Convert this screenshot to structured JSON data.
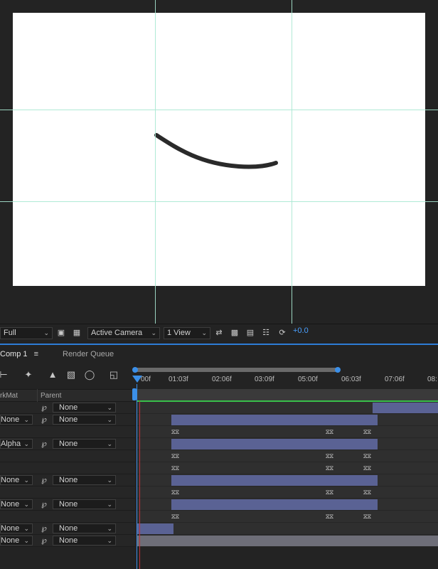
{
  "viewer": {
    "resolution": "Full",
    "camera": "Active Camera",
    "views": "1 View",
    "exposure": "+0.0"
  },
  "tabs": {
    "comp": "Comp 1",
    "render_queue": "Render Queue"
  },
  "ruler": {
    "ticks": [
      "00f",
      "01:03f",
      "02:06f",
      "03:09f",
      "05:00f",
      "06:03f",
      "07:06f",
      "08:"
    ]
  },
  "columns": {
    "trkmat": "rkMat",
    "parent": "Parent"
  },
  "layers": [
    {
      "trkmat": "",
      "parent": "None"
    },
    {
      "trkmat": "None",
      "parent": "None"
    },
    {
      "trkmat": "",
      "parent": ""
    },
    {
      "trkmat": "Alpha",
      "parent": "None"
    },
    {
      "trkmat": "",
      "parent": ""
    },
    {
      "trkmat": "",
      "parent": ""
    },
    {
      "trkmat": "None",
      "parent": "None"
    },
    {
      "trkmat": "",
      "parent": ""
    },
    {
      "trkmat": "None",
      "parent": "None"
    },
    {
      "trkmat": "",
      "parent": ""
    },
    {
      "trkmat": "None",
      "parent": "None"
    },
    {
      "trkmat": "None",
      "parent": "None"
    }
  ],
  "icons": {
    "menu": "hamburger-icon",
    "spiral": "pickwhip-icon"
  }
}
